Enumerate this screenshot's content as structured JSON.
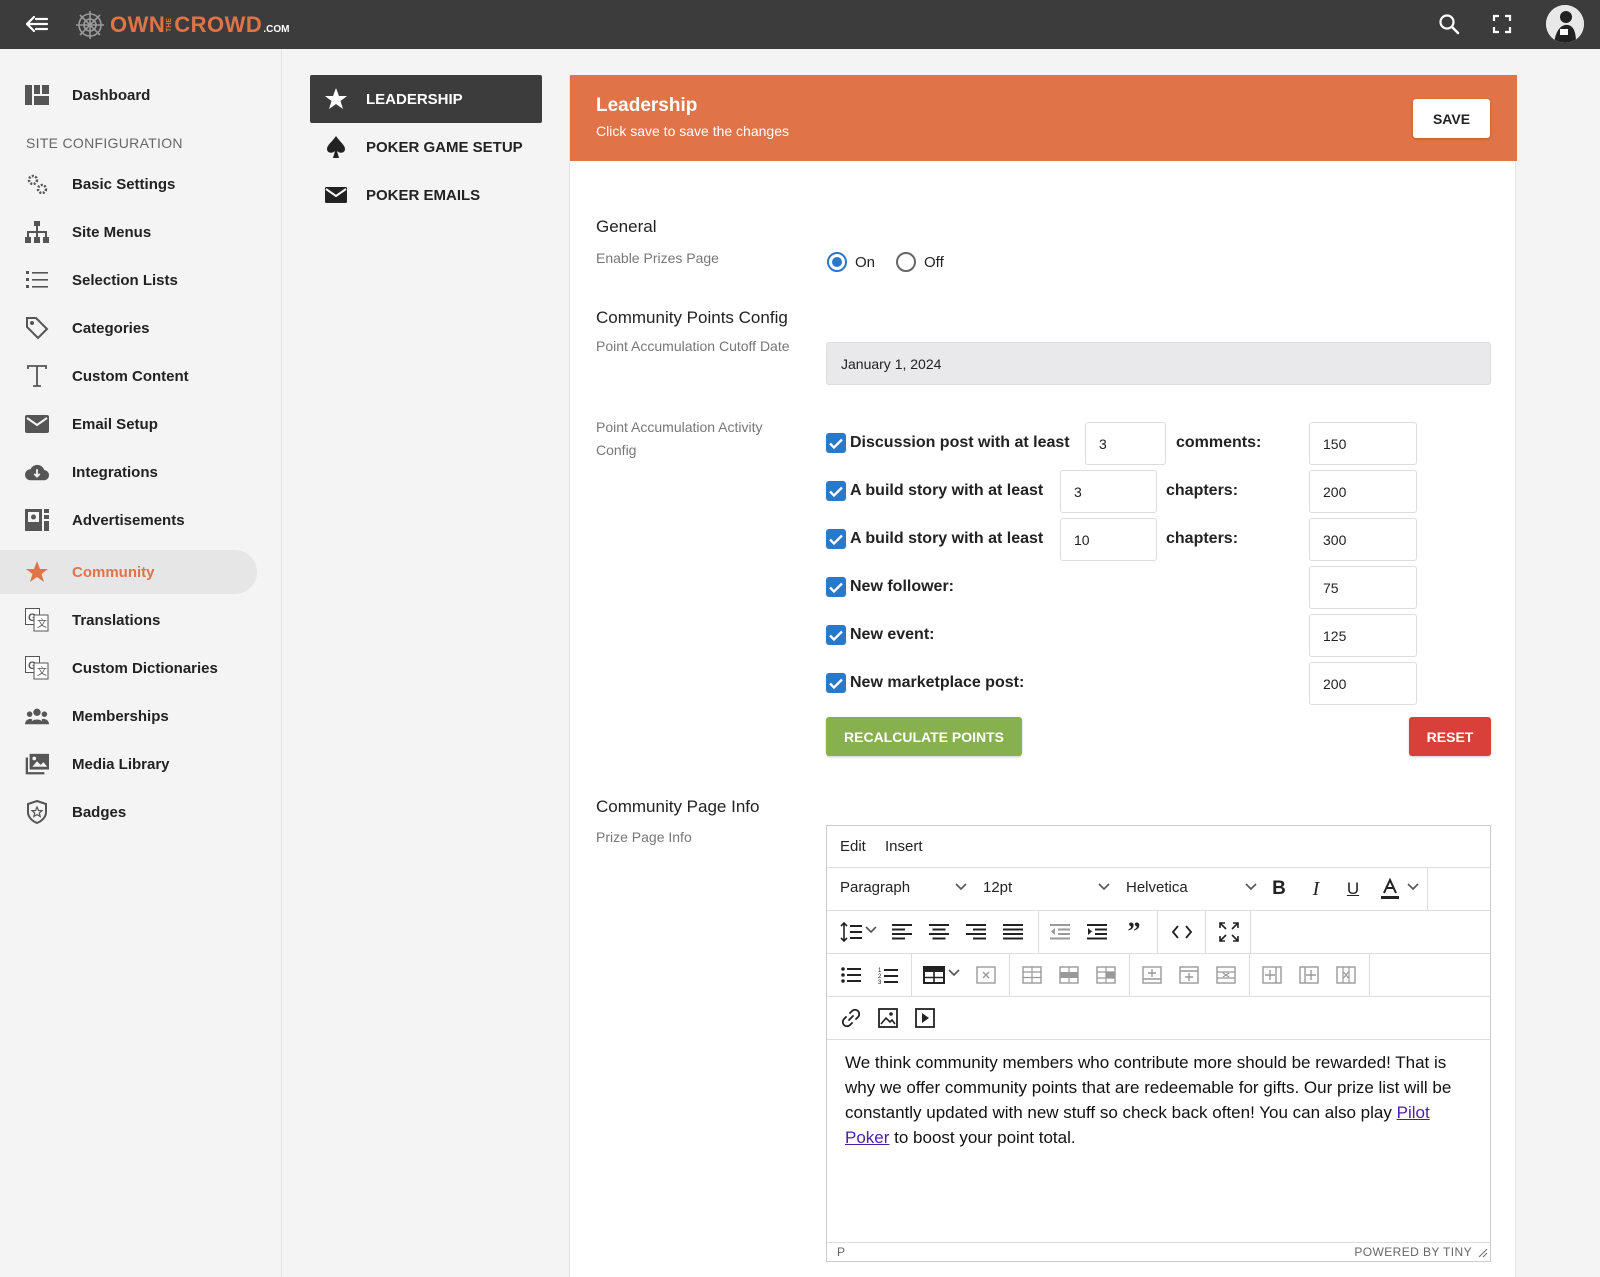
{
  "brand": {
    "own": "OWN",
    "the": "THE",
    "crowd": "CROWD",
    "com": ".COM",
    "accent": "#e07448"
  },
  "sidebar": {
    "heading": "SITE CONFIGURATION",
    "items": [
      {
        "label": "Dashboard",
        "icon": "dashboard-icon"
      },
      {
        "label": "Basic Settings",
        "icon": "gears-icon"
      },
      {
        "label": "Site Menus",
        "icon": "sitemap-icon"
      },
      {
        "label": "Selection Lists",
        "icon": "list-icon"
      },
      {
        "label": "Categories",
        "icon": "tag-icon"
      },
      {
        "label": "Custom Content",
        "icon": "text-icon"
      },
      {
        "label": "Email Setup",
        "icon": "envelope-icon"
      },
      {
        "label": "Integrations",
        "icon": "cloud-icon"
      },
      {
        "label": "Advertisements",
        "icon": "ad-icon"
      },
      {
        "label": "Community",
        "icon": "star-icon",
        "active": true
      },
      {
        "label": "Translations",
        "icon": "translate-icon"
      },
      {
        "label": "Custom Dictionaries",
        "icon": "translate-icon"
      },
      {
        "label": "Memberships",
        "icon": "users-icon"
      },
      {
        "label": "Media Library",
        "icon": "images-icon"
      },
      {
        "label": "Badges",
        "icon": "badge-icon"
      }
    ]
  },
  "subnav": {
    "items": [
      {
        "label": "LEADERSHIP",
        "icon": "star-icon",
        "active": true
      },
      {
        "label": "POKER GAME SETUP",
        "icon": "spade-icon"
      },
      {
        "label": "POKER EMAILS",
        "icon": "envelope-icon"
      }
    ]
  },
  "panel": {
    "title": "Leadership",
    "subtitle": "Click save to save the changes",
    "save_label": "SAVE",
    "general": {
      "title": "General",
      "enable_prizes_label": "Enable Prizes Page",
      "on_label": "On",
      "off_label": "Off",
      "selected": "On"
    },
    "points": {
      "title": "Community Points Config",
      "cutoff_label": "Point Accumulation Cutoff Date",
      "cutoff_value": "January 1, 2024",
      "activity_label": "Point Accumulation Activity Config",
      "rows": [
        {
          "label": "Discussion post with at least",
          "count": "3",
          "suffix": "comments:",
          "points": "150",
          "checked": true
        },
        {
          "label": "A build story with at least",
          "count": "3",
          "suffix": "chapters:",
          "points": "200",
          "checked": true
        },
        {
          "label": "A build story with at least",
          "count": "10",
          "suffix": "chapters:",
          "points": "300",
          "checked": true
        },
        {
          "label": "New follower:",
          "points": "75",
          "checked": true
        },
        {
          "label": "New event:",
          "points": "125",
          "checked": true
        },
        {
          "label": "New marketplace post:",
          "points": "200",
          "checked": true
        }
      ],
      "recalc_label": "RECALCULATE POINTS",
      "reset_label": "RESET"
    },
    "community_info": {
      "title": "Community Page Info",
      "prize_label": "Prize Page Info"
    }
  },
  "editor": {
    "menus": [
      "Edit",
      "Insert"
    ],
    "block_format": "Paragraph",
    "font_size": "12pt",
    "font_family": "Helvetica",
    "content_before_link": "We think community members who contribute more should be rewarded! That is why we offer community points that are redeemable for gifts.  Our prize list will be constantly updated with new stuff so check back often! You can also play ",
    "link_text": "Pilot Poker",
    "content_after_link": " to boost your point total.",
    "status_path": "P",
    "powered_by": "POWERED BY TINY"
  },
  "colors": {
    "topbar": "#3c3c3c",
    "checkbox": "#2a78c8",
    "recalc": "#87b04f",
    "reset": "#d9403a"
  }
}
